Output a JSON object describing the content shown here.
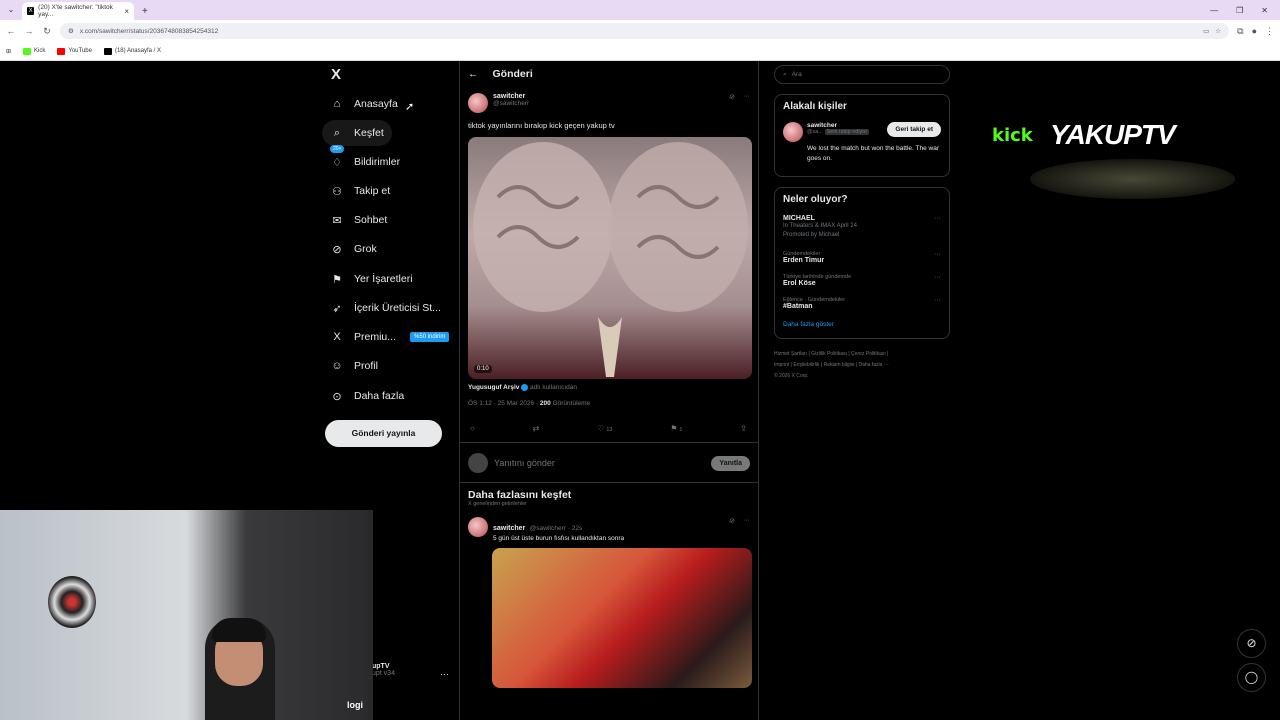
{
  "browser": {
    "tab_title": "(20) X'te sawitcher: \"tiktok yay...",
    "new_tab": "+",
    "url": "x.com/sawitcherr/status/2036748083854254312",
    "bookmarks": [
      {
        "label": "Kick",
        "color": "#53fc18"
      },
      {
        "label": "YouTube",
        "color": "#ff0000"
      },
      {
        "label": "(18) Anasayfa / X",
        "color": "#000000"
      }
    ]
  },
  "nav": {
    "logo": "X",
    "items": [
      {
        "label": "Anasayfa",
        "icon": "home-icon",
        "glyph": "⌂"
      },
      {
        "label": "Keşfet",
        "icon": "search-icon",
        "glyph": "⌕"
      },
      {
        "label": "Bildirimler",
        "icon": "bell-icon",
        "glyph": "♢",
        "badge": "20+"
      },
      {
        "label": "Takip et",
        "icon": "follow-icon",
        "glyph": "⚇"
      },
      {
        "label": "Sohbet",
        "icon": "mail-icon",
        "glyph": "✉"
      },
      {
        "label": "Grok",
        "icon": "grok-icon",
        "glyph": "⊘"
      },
      {
        "label": "Yer İşaretleri",
        "icon": "bookmark-icon",
        "glyph": "⚑"
      },
      {
        "label": "İçerik Üreticisi St...",
        "icon": "rocket-icon",
        "glyph": "➶"
      },
      {
        "label": "Premiu...",
        "icon": "x-premium-icon",
        "glyph": "X",
        "promo": "%50 indirim"
      },
      {
        "label": "Profil",
        "icon": "profile-icon",
        "glyph": "☺"
      },
      {
        "label": "Daha fazla",
        "icon": "more-icon",
        "glyph": "⊙"
      }
    ],
    "post_button": "Gönderi yayınla",
    "mini_profile_name": "upTV",
    "mini_profile_handle": "upt v34",
    "more": "···"
  },
  "main": {
    "header": "Gönderi",
    "post": {
      "name": "sawitcher",
      "handle": "@sawitcherr",
      "text": "tiktok yayınlarını bırakıp kick geçen yakup tv",
      "duration": "0:10",
      "attribution_name": "Yugusuguf Arşiv",
      "attribution_suffix": "adlı kullanıcıdan",
      "time": "ÖS 1:12 · 25 Mar 2026 ·",
      "views": "200",
      "views_label": "Görüntüleme",
      "likes": "13",
      "bookmarks": "1"
    },
    "reply_placeholder": "Yanıtını gönder",
    "reply_button": "Yanıtla",
    "discover_title": "Daha fazlasını keşfet",
    "discover_sub": "X genelinden getirilenler",
    "post2": {
      "name": "sawitcher",
      "handle": "@sawitcherr · 22s",
      "text": "5 gün üst üste burun fısfısı kullandıktan sonra"
    }
  },
  "right": {
    "search_placeholder": "Ara",
    "who_title": "Alakalı kişiler",
    "who": {
      "name": "sawitcher",
      "handle": "@sa...",
      "follows_you": "Seni takip ediyor",
      "button": "Geri takip et",
      "bio": "We lost the match but won the battle. The war goes on."
    },
    "trends_title": "Neler oluyor?",
    "trends": [
      {
        "category": "",
        "title": "MICHAEL",
        "extra1": "In Theaters & IMAX April 24",
        "extra2": "Promoted by Michael"
      },
      {
        "category": "Gündemdekiler",
        "title": "Erden Timur",
        "extra1": "",
        "extra2": ""
      },
      {
        "category": "Türkiye tarihinde gündemde",
        "title": "Erol Köse",
        "extra1": "",
        "extra2": ""
      },
      {
        "category": "Eğlence · Gündemdekiler",
        "title": "#Batman",
        "extra1": "",
        "extra2": ""
      }
    ],
    "show_more": "Daha fazla göster",
    "footer_line1": "Hizmet Şartları  |  Gizlilik Politikası  |  Çerez Politikası  |",
    "footer_line2": "Imprint  |  Erişilebilirlik  |  Reklam bilgisi  |  Daha fazla ···",
    "footer_line3": "© 2026 X Corp."
  },
  "overlay": {
    "kick": "kick",
    "brand": "YAKUPTV",
    "logi": "logi"
  },
  "colors": {
    "accent": "#1d9bf0",
    "kick_green": "#53fc18",
    "border": "#2f3336"
  }
}
